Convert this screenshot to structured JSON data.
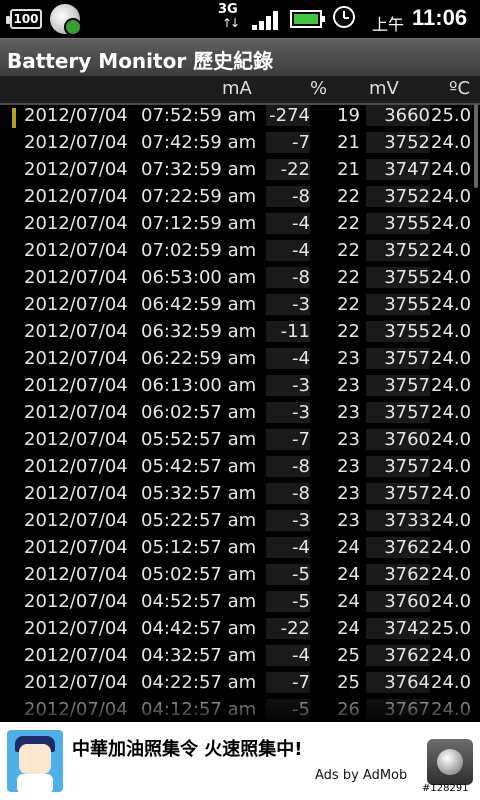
{
  "status_bar": {
    "battery_badge": "100",
    "network": "3G",
    "arrows": "↑↓",
    "ampm": "上午",
    "time": "11:06"
  },
  "title": "Battery Monitor 歷史紀錄",
  "columns": [
    "mA",
    "%",
    "mV",
    "ºC"
  ],
  "rows": [
    {
      "date": "2012/07/04",
      "time": "07:52:59 am",
      "ma": "-274",
      "pct": "19",
      "mv": "3660",
      "temp": "25.0"
    },
    {
      "date": "2012/07/04",
      "time": "07:42:59 am",
      "ma": "-7",
      "pct": "21",
      "mv": "3752",
      "temp": "24.0"
    },
    {
      "date": "2012/07/04",
      "time": "07:32:59 am",
      "ma": "-22",
      "pct": "21",
      "mv": "3747",
      "temp": "24.0"
    },
    {
      "date": "2012/07/04",
      "time": "07:22:59 am",
      "ma": "-8",
      "pct": "22",
      "mv": "3752",
      "temp": "24.0"
    },
    {
      "date": "2012/07/04",
      "time": "07:12:59 am",
      "ma": "-4",
      "pct": "22",
      "mv": "3755",
      "temp": "24.0"
    },
    {
      "date": "2012/07/04",
      "time": "07:02:59 am",
      "ma": "-4",
      "pct": "22",
      "mv": "3752",
      "temp": "24.0"
    },
    {
      "date": "2012/07/04",
      "time": "06:53:00 am",
      "ma": "-8",
      "pct": "22",
      "mv": "3755",
      "temp": "24.0"
    },
    {
      "date": "2012/07/04",
      "time": "06:42:59 am",
      "ma": "-3",
      "pct": "22",
      "mv": "3755",
      "temp": "24.0"
    },
    {
      "date": "2012/07/04",
      "time": "06:32:59 am",
      "ma": "-11",
      "pct": "22",
      "mv": "3755",
      "temp": "24.0"
    },
    {
      "date": "2012/07/04",
      "time": "06:22:59 am",
      "ma": "-4",
      "pct": "23",
      "mv": "3757",
      "temp": "24.0"
    },
    {
      "date": "2012/07/04",
      "time": "06:13:00 am",
      "ma": "-3",
      "pct": "23",
      "mv": "3757",
      "temp": "24.0"
    },
    {
      "date": "2012/07/04",
      "time": "06:02:57 am",
      "ma": "-3",
      "pct": "23",
      "mv": "3757",
      "temp": "24.0"
    },
    {
      "date": "2012/07/04",
      "time": "05:52:57 am",
      "ma": "-7",
      "pct": "23",
      "mv": "3760",
      "temp": "24.0"
    },
    {
      "date": "2012/07/04",
      "time": "05:42:57 am",
      "ma": "-8",
      "pct": "23",
      "mv": "3757",
      "temp": "24.0"
    },
    {
      "date": "2012/07/04",
      "time": "05:32:57 am",
      "ma": "-8",
      "pct": "23",
      "mv": "3757",
      "temp": "24.0"
    },
    {
      "date": "2012/07/04",
      "time": "05:22:57 am",
      "ma": "-3",
      "pct": "23",
      "mv": "3733",
      "temp": "24.0"
    },
    {
      "date": "2012/07/04",
      "time": "05:12:57 am",
      "ma": "-4",
      "pct": "24",
      "mv": "3762",
      "temp": "24.0"
    },
    {
      "date": "2012/07/04",
      "time": "05:02:57 am",
      "ma": "-5",
      "pct": "24",
      "mv": "3762",
      "temp": "24.0"
    },
    {
      "date": "2012/07/04",
      "time": "04:52:57 am",
      "ma": "-5",
      "pct": "24",
      "mv": "3760",
      "temp": "24.0"
    },
    {
      "date": "2012/07/04",
      "time": "04:42:57 am",
      "ma": "-22",
      "pct": "24",
      "mv": "3742",
      "temp": "25.0"
    },
    {
      "date": "2012/07/04",
      "time": "04:32:57 am",
      "ma": "-4",
      "pct": "25",
      "mv": "3762",
      "temp": "24.0"
    },
    {
      "date": "2012/07/04",
      "time": "04:22:57 am",
      "ma": "-7",
      "pct": "25",
      "mv": "3764",
      "temp": "24.0"
    },
    {
      "date": "2012/07/04",
      "time": "04:12:57 am",
      "ma": "-5",
      "pct": "26",
      "mv": "3767",
      "temp": "24.0"
    }
  ],
  "ad": {
    "text": "中華加油照集令 火速照集中!",
    "by": "Ads by AdMob"
  },
  "watermark": "#128291",
  "colors": {
    "marker": "#b3a11f",
    "battery_fill": "#41c63f",
    "header_bg": "#4a4a4a"
  }
}
